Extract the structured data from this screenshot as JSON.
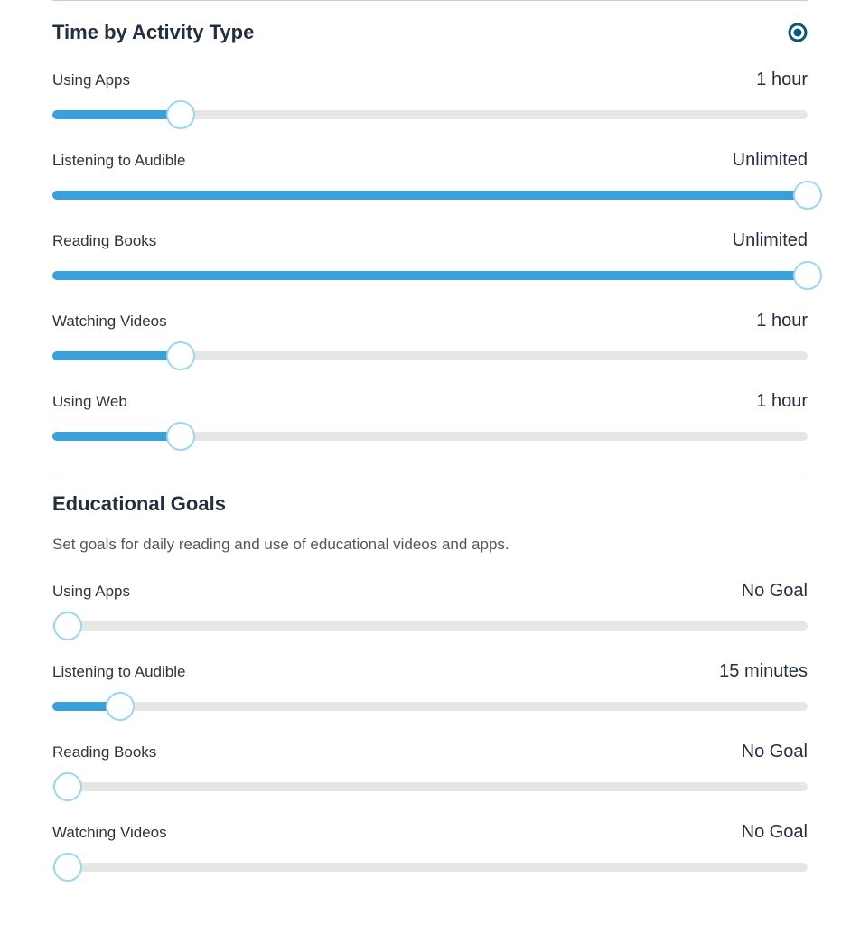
{
  "timeByActivity": {
    "title": "Time by Activity Type",
    "items": [
      {
        "label": "Using Apps",
        "value": "1 hour",
        "percent": 17
      },
      {
        "label": "Listening to Audible",
        "value": "Unlimited",
        "percent": 100
      },
      {
        "label": "Reading Books",
        "value": "Unlimited",
        "percent": 100
      },
      {
        "label": "Watching Videos",
        "value": "1 hour",
        "percent": 17
      },
      {
        "label": "Using Web",
        "value": "1 hour",
        "percent": 17
      }
    ]
  },
  "educationalGoals": {
    "title": "Educational Goals",
    "description": "Set goals for daily reading and use of educational videos and apps.",
    "items": [
      {
        "label": "Using Apps",
        "value": "No Goal",
        "percent": 0
      },
      {
        "label": "Listening to Audible",
        "value": "15 minutes",
        "percent": 9
      },
      {
        "label": "Reading Books",
        "value": "No Goal",
        "percent": 0
      },
      {
        "label": "Watching Videos",
        "value": "No Goal",
        "percent": 0
      }
    ]
  }
}
